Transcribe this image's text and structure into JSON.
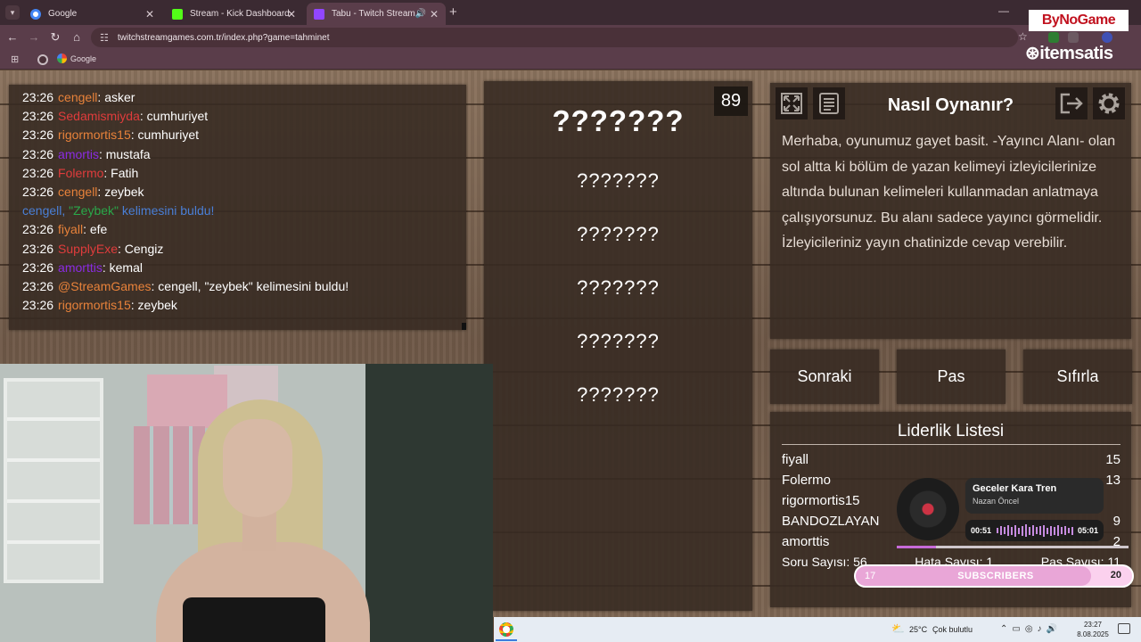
{
  "browser": {
    "tabs": [
      {
        "title": "Google",
        "favicon_color": "#4285f4",
        "active": false
      },
      {
        "title": "Stream - Kick Dashboard",
        "favicon_color": "#53fc18",
        "active": false
      },
      {
        "title": "Tabu - Twitch Stream Game",
        "favicon_color": "#9146ff",
        "active": true
      }
    ],
    "url": "twitchstreamgames.com.tr/index.php?game=tahminet",
    "bookmark": "Google"
  },
  "chat": {
    "messages": [
      {
        "time": "23:26",
        "user": "cengell",
        "color": "#e8823a",
        "text": ": asker"
      },
      {
        "time": "23:26",
        "user": "Sedamismiyda",
        "color": "#e03c3c",
        "text": ": cumhuriyet"
      },
      {
        "time": "23:26",
        "user": "rigormortis15",
        "color": "#e8823a",
        "text": ": cumhuriyet"
      },
      {
        "time": "23:26",
        "user": "amortis",
        "color": "#8a2be2",
        "text": ": mustafa"
      },
      {
        "time": "23:26",
        "user": "Folermo",
        "color": "#e03c3c",
        "text": ": Fatih"
      },
      {
        "time": "23:26",
        "user": "cengell",
        "color": "#e8823a",
        "text": ": zeybek"
      },
      {
        "time": "23:26",
        "user": "fiyall",
        "color": "#e8823a",
        "text": ": efe"
      },
      {
        "time": "23:26",
        "user": "SupplyExe",
        "color": "#e03c3c",
        "text": ": Cengiz"
      },
      {
        "time": "23:26",
        "user": "amorttis",
        "color": "#8a2be2",
        "text": ": kemal"
      },
      {
        "time": "23:26",
        "user": "@StreamGames",
        "color": "#e8823a",
        "text": ": cengell, \"zeybek\" kelimesini buldu!"
      },
      {
        "time": "23:26",
        "user": "rigormortis15",
        "color": "#e8823a",
        "text": ": zeybek"
      }
    ],
    "system": {
      "user": "cengell, ",
      "word": "\"Zeybek\"",
      "rest": " kelimesini buldu!"
    }
  },
  "game": {
    "main_word": "???????",
    "forbidden_words": [
      "???????",
      "???????",
      "???????",
      "???????",
      "???????"
    ],
    "timer": "89"
  },
  "howto": {
    "title": "Nasıl Oynanır?",
    "body": "Merhaba, oyunumuz gayet basit. -Yayıncı Alanı- olan sol altta ki bölüm de yazan kelimeyi izleyicilerinize altında bulunan kelimeleri kullanmadan anlatmaya çalışıyorsunuz. Bu alanı sadece yayıncı görmelidir. İzleyicileriniz yayın chatinizde cevap verebilir.",
    "icons": [
      "fullscreen-icon",
      "notes-icon",
      "exit-icon",
      "gear-icon"
    ]
  },
  "controls": {
    "next": "Sonraki",
    "pass": "Pas",
    "reset": "Sıfırla"
  },
  "leaderboard": {
    "title": "Liderlik Listesi",
    "rows": [
      {
        "name": "fiyall",
        "score": "15"
      },
      {
        "name": "Folermo",
        "score": "13"
      },
      {
        "name": "rigormortis15",
        "score": ""
      },
      {
        "name": "BANDOZLAYAN",
        "score": "9"
      },
      {
        "name": "amorttis",
        "score": "2"
      }
    ],
    "stats": {
      "questions": "Soru Sayısı: 56",
      "errors": "Hata Sayısı: 1",
      "passes": "Pas Sayısı: 11"
    }
  },
  "music": {
    "title": "Geceler Kara Tren",
    "artist": "Nazan Öncel",
    "elapsed": "00:51",
    "total": "05:01",
    "progress": 0.17
  },
  "subs": {
    "current": "17",
    "label": "SUBSCRIBERS",
    "goal": "20",
    "fraction": 0.85
  },
  "logos": {
    "bynogame": "ByNoGame",
    "itemsatis": "itemsatis"
  },
  "taskbar": {
    "temp": "25°C",
    "weather": "Çok bulutlu",
    "time": "23:27",
    "date": "8.08.2025"
  }
}
